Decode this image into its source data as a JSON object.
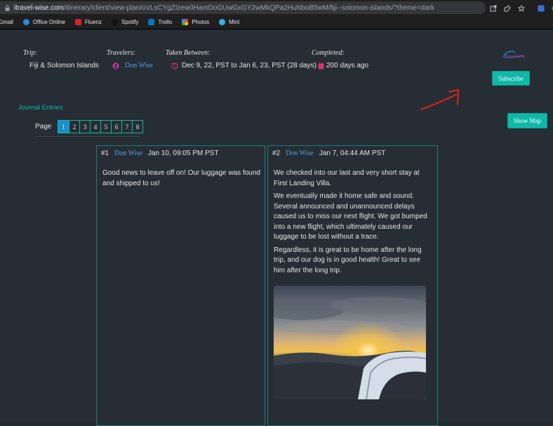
{
  "browser": {
    "url_domain": "itravel-wise.com",
    "url_path": "/itinerary/client/view-plan/oVLsCYgZIzew0HamDoGUwGxGY2wMkQPa2HuNboB5wM/fiji--solomon-islands/?theme=dark",
    "icons": [
      "share-icon",
      "extension-icon",
      "star-icon",
      "sidebar-icon",
      "profile-icon"
    ]
  },
  "bookmarks": [
    {
      "label": "Gmail",
      "color": "#ea4335"
    },
    {
      "label": "Office Online",
      "color": "#2b88d8"
    },
    {
      "label": "Fluenz",
      "color": "#d0232f"
    },
    {
      "label": "Spotify",
      "color": "#1f1f1f"
    },
    {
      "label": "Trello",
      "color": "#0079bf"
    },
    {
      "label": "Photos",
      "color": "#fbbc04"
    },
    {
      "label": "Mint",
      "color": "#3ab0e2"
    }
  ],
  "trip": {
    "trip_label": "Trip:",
    "trip_value": "Fiji & Solomon Islands",
    "travelers_label": "Travelers:",
    "traveler": "Don Wise",
    "taken_label": "Taken Between:",
    "taken_value": "Dec 9, 22, PST to Jan 6, 23, PST (28 days)",
    "completed_label": "Completed:",
    "completed_value": "200 days ago"
  },
  "subscribe_label": "Subscribe",
  "show_map_label": "Show Map",
  "journal_label": "Journal Entries:",
  "page_label": "Page",
  "pages": [
    "1",
    "2",
    "3",
    "4",
    "5",
    "6",
    "7",
    "8"
  ],
  "entries": [
    {
      "num": "#1",
      "author": "Don Wise",
      "date": "Jan 10, 09:05 PM PST",
      "paragraphs": [
        "Good news to leave off on! Our luggage was found and shipped to us!"
      ]
    },
    {
      "num": "#2",
      "author": "Don Wise",
      "date": "Jan 7, 04:44 AM PST",
      "paragraphs": [
        "We checked into our last and very short stay at First Landing Villa.",
        "We eventually made it home safe and sound. Several announced and unannounced delays caused us to miss our next flight. We got bumped into a new flight, which ultimately caused our luggage to be lost without a trace.",
        "Regardless, it is great to be home after the long trip, and our dog is in good health! Great to see him after the long trip."
      ]
    }
  ],
  "colors": {
    "accent": "#10b8a8",
    "link": "#4aa3e8",
    "annotation": "#e02020"
  }
}
